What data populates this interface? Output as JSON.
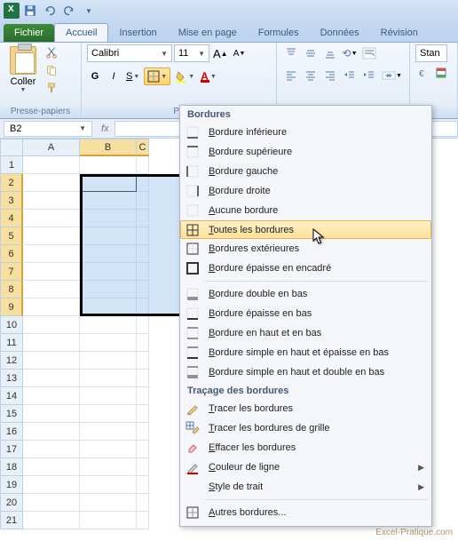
{
  "qat": {
    "save_title": "Enregistrer",
    "undo_title": "Annuler",
    "redo_title": "Rétablir"
  },
  "tabs": {
    "file": "Fichier",
    "home": "Accueil",
    "insert": "Insertion",
    "layout": "Mise en page",
    "formulas": "Formules",
    "data": "Données",
    "review": "Révision"
  },
  "ribbon": {
    "clipboard": {
      "label": "Presse-papiers",
      "paste": "Coller"
    },
    "font": {
      "label_short": "Po",
      "name": "Calibri",
      "size": "11",
      "bold": "G",
      "italic": "I",
      "underline": "S"
    },
    "styles_cut": "Stan"
  },
  "namebox": "B2",
  "columns": [
    "A",
    "B",
    "C"
  ],
  "rows": [
    "1",
    "2",
    "3",
    "4",
    "5",
    "6",
    "7",
    "8",
    "9",
    "10",
    "11",
    "12",
    "13",
    "14",
    "15",
    "16",
    "17",
    "18",
    "19",
    "20",
    "21"
  ],
  "selected_rows": [
    "2",
    "3",
    "4",
    "5",
    "6",
    "7",
    "8",
    "9"
  ],
  "selection": {
    "start": "B2",
    "end": "C9",
    "active": "B2"
  },
  "dropdown": {
    "title": "Bordures",
    "section2": "Traçage des bordures",
    "items": {
      "bottom": "Bordure inférieure",
      "top": "Bordure supérieure",
      "left": "Bordure gauche",
      "right": "Bordure droite",
      "none": "Aucune bordure",
      "all": "Toutes les bordures",
      "outside": "Bordures extérieures",
      "thick": "Bordure épaisse en encadré",
      "double_bottom": "Bordure double en bas",
      "thick_bottom": "Bordure épaisse en bas",
      "top_bottom": "Bordure en haut et en bas",
      "top_thick_bottom": "Bordure simple en haut et épaisse en bas",
      "top_double_bottom": "Bordure simple en haut et double en bas",
      "draw": "Tracer les bordures",
      "draw_grid": "Tracer les bordures de grille",
      "erase": "Effacer les bordures",
      "color": "Couleur de ligne",
      "style": "Style de trait",
      "more": "Autres bordures..."
    }
  },
  "watermark": "Excel-Pratique.com"
}
